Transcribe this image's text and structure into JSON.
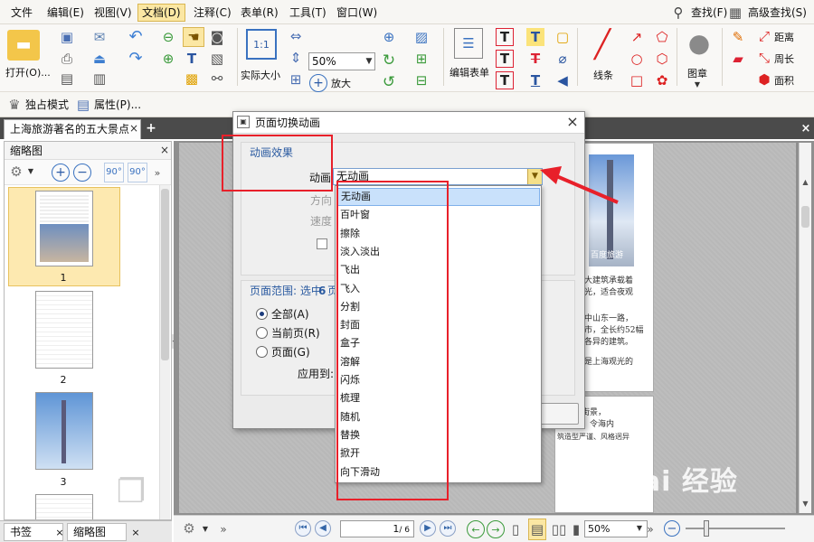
{
  "menubar": {
    "items": [
      "文件",
      "编辑(E)",
      "视图(V)",
      "文档(D)",
      "注释(C)",
      "表单(R)",
      "工具(T)",
      "窗口(W)"
    ],
    "active": "文档(D)",
    "search_label": "查找(F)",
    "advanced_search_label": "高级查找(S)"
  },
  "toolbar": {
    "open_label": "打开(O)...",
    "actual_size_label": "实际大小",
    "zoom_value": "50%",
    "zoom_in_label": "放大",
    "zoom_out_label": "缩小",
    "edit_form_label": "编辑表单",
    "line_label": "线条",
    "stamp_label": "图章",
    "distance_label": "距离",
    "perimeter_label": "周长",
    "area_label": "面积"
  },
  "toolbar2": {
    "exclusive_mode_label": "独占模式",
    "properties_label": "属性(P)..."
  },
  "tabs": {
    "document_tab": "上海旅游著名的五大景点"
  },
  "sidebar": {
    "title": "缩略图",
    "pages": [
      "1",
      "2",
      "3"
    ],
    "bottom_tabs": [
      "书签",
      "缩略图"
    ]
  },
  "document": {
    "image_caption": "百度旅游",
    "lines": [
      "大建筑承载着",
      "光，适合夜观",
      "中山东一路，",
      "市，全长约52幅",
      "各异的建筑。",
      "是上海观光的",
      "构成的街景，",
      "的夜晚，令海内",
      "筑造型严谨、风格迥异"
    ]
  },
  "dialog": {
    "title": "页面切换动画",
    "group_effect": "动画效果",
    "animation_label": "动画",
    "direction_label": "方向",
    "speed_label": "速度",
    "selected_animation": "无动画",
    "range_label": "页面范围: 选中",
    "range_count": "6",
    "range_suffix": "页",
    "radio_all": "全部(A)",
    "radio_current": "当前页(R)",
    "radio_pages": "页面(G)",
    "apply_to": "应用到:",
    "options": [
      "无动画",
      "百叶窗",
      "擦除",
      "淡入淡出",
      "飞出",
      "飞入",
      "分割",
      "封面",
      "盒子",
      "溶解",
      "闪烁",
      "梳理",
      "随机",
      "替换",
      "掀开",
      "向下滑动"
    ]
  },
  "statusbar": {
    "page_value": "1",
    "page_total": "/ 6",
    "zoom_value": "50%"
  },
  "watermark": {
    "text": "Bai 经验"
  }
}
